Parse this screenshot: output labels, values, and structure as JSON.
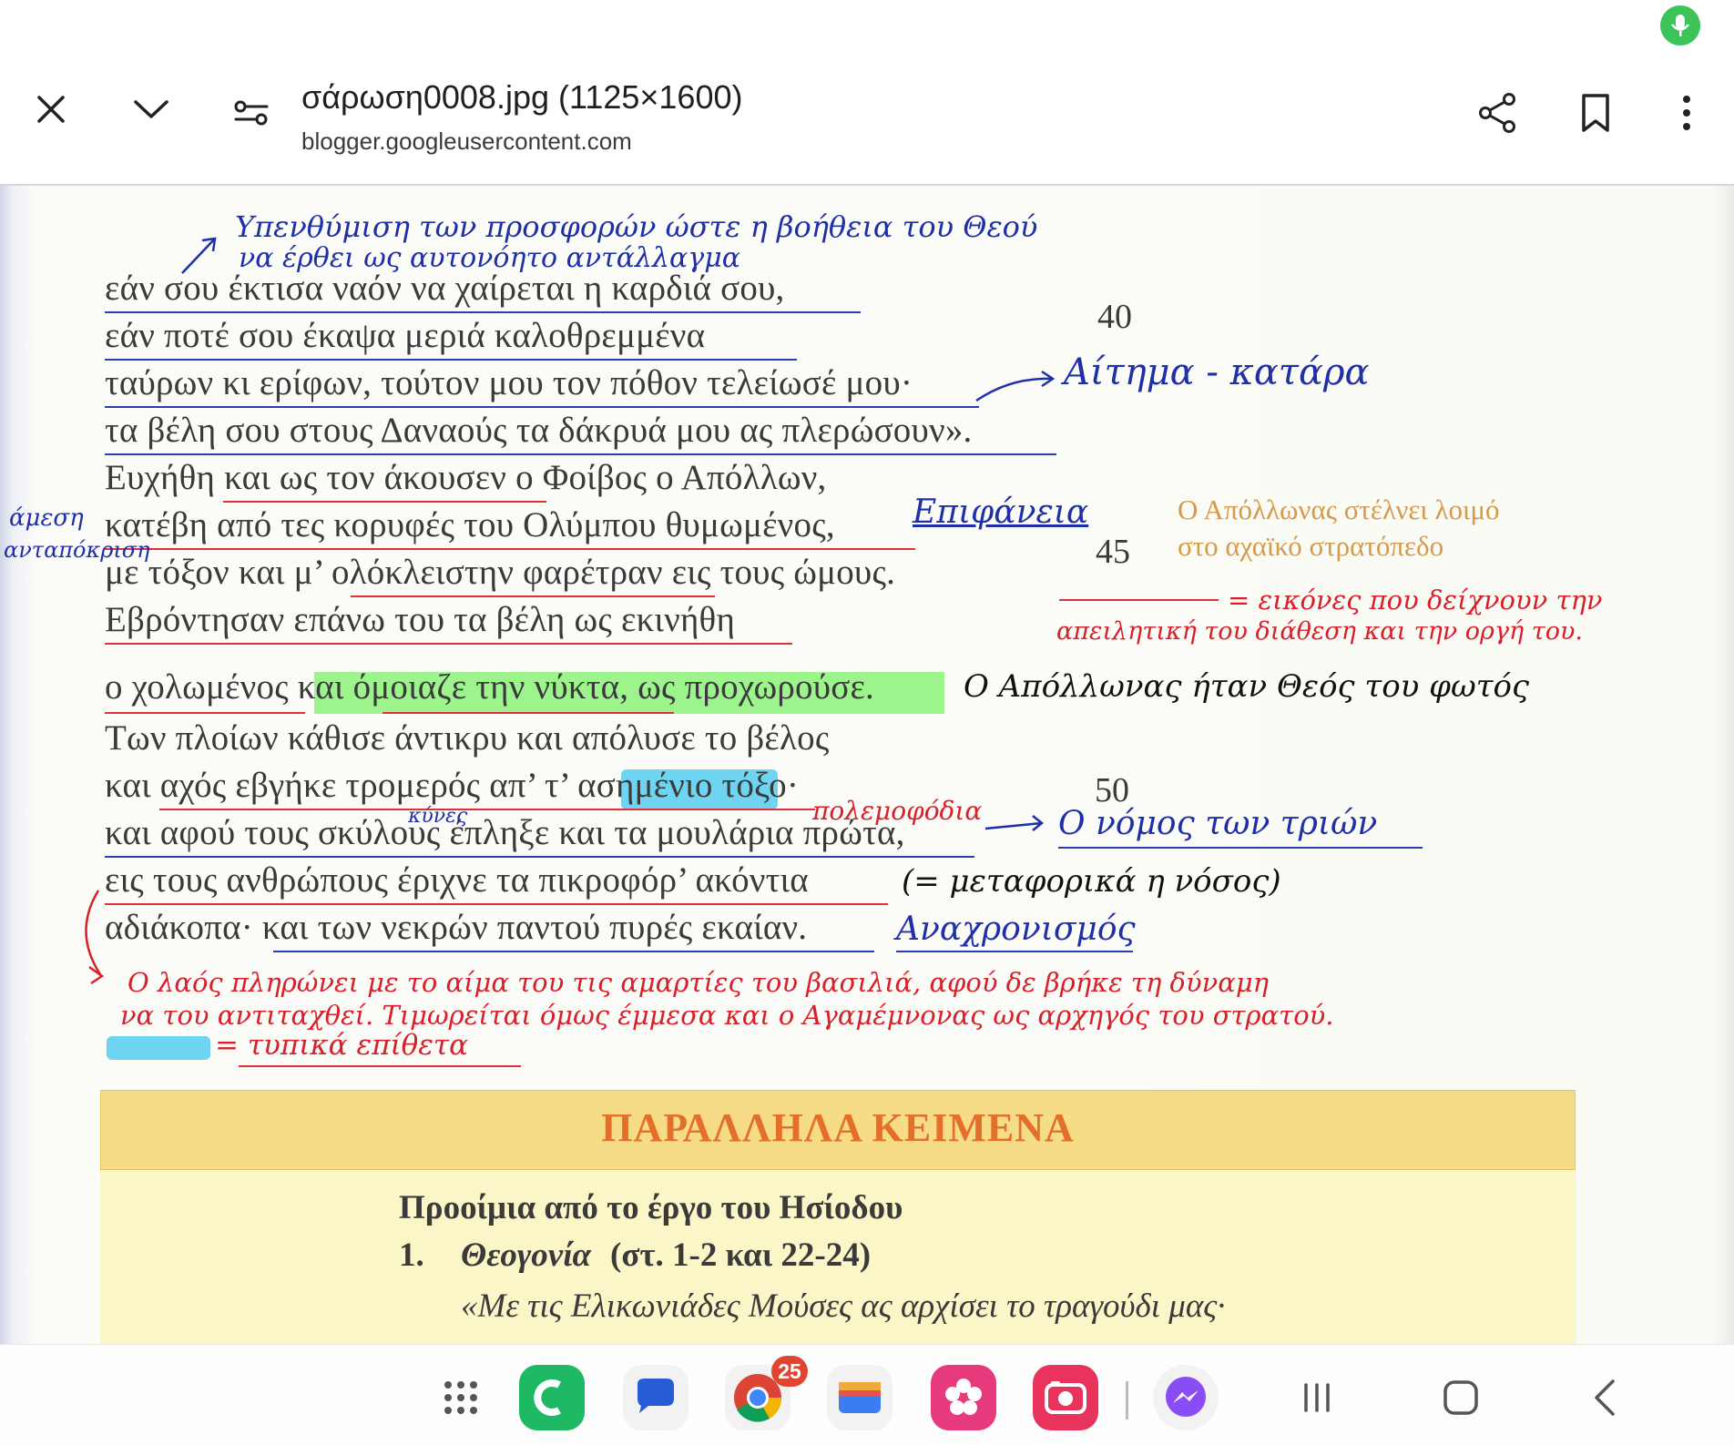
{
  "header": {
    "title": "σάρωση0008.jpg (1125×1600)",
    "url": "blogger.googleusercontent.com"
  },
  "icons": {
    "close": "close-icon",
    "collapse": "chevron-down-icon",
    "site_settings": "tune-icon",
    "share": "share-icon",
    "bookmark": "bookmark-icon",
    "menu": "more-vert-icon",
    "mic": "mic-icon"
  },
  "poem": {
    "lines": [
      "εάν σου έκτισα ναόν να χαίρεται η καρδιά σου,",
      "εάν ποτέ σου έκαψα μεριά καλοθρεμμένα",
      "ταύρων κι ερίφων, τούτον μου τον πόθον τελείωσέ μου·",
      "τα βέλη σου στους Δαναούς τα δάκρυά μου ας πλερώσουν».",
      "Ευχήθη και ως τον άκουσεν ο Φοίβος ο Απόλλων,",
      "κατέβη από τες κορυφές του Ολύμπου θυμωμένος,",
      "με τόξον και μ’ ολόκλειστην φαρέτραν εις τους ώμους.",
      "Εβρόντησαν επάνω του τα βέλη ως εκινήθη",
      "ο χολωμένος και όμοιαζε την νύκτα, ως προχωρούσε.",
      "Των πλοίων κάθισε άντικρυ και απόλυσε το βέλος",
      "και αχός εβγήκε τρομερός απ’ τ’ ασημένιο τόξο·",
      "και αφού τους σκύλους έπληξε και τα μουλάρια πρώτα,",
      "εις τους ανθρώπους έριχνε τα πικροφόρ’ ακόντια",
      "αδιάκοπα· και των νεκρών παντού πυρές εκαίαν."
    ],
    "line_numbers": [
      "40",
      "45",
      "50"
    ]
  },
  "annotations": {
    "top_note_1": "Υπενθύμιση των προσφορών ώστε η βοήθεια του Θεού",
    "top_note_2": "να έρθει ως αυτονόητο αντάλλαγμα",
    "curse": "Αίτημα - κατάρα",
    "direct_1": "άμεση",
    "direct_2": "ανταπόκριση",
    "epiphany": "Επιφάνεια",
    "side_note_1": "Ο Απόλλωνας στέλνει λοιμό",
    "side_note_2": "στο αχαϊκό στρατόπεδο",
    "images_1": "= εικόνες που δείχνουν την",
    "images_2": "απειλητική του διάθεση και την οργή του.",
    "light_god": "Ο Απόλλωνας ήταν Θεός του φωτός",
    "dogs": "κύνες",
    "pack_animals": "πολεμοφόδια",
    "law_of_three": "Ο νόμος των τριών",
    "metaphor": "(= μεταφορικά η νόσος)",
    "anachronism": "Αναχρονισμός",
    "bottom_1": "Ο λαός πληρώνει με το αίμα του τις αμαρτίες του βασιλιά, αφού δε βρήκε τη δύναμη",
    "bottom_2": "να του αντιταχθεί. Τιμωρείται όμως έμμεσα και ο Αγαμέμνονας ως αρχηγός του στρατού.",
    "epithets": "= τυπικά επίθετα"
  },
  "parallel": {
    "title": "ΠΑΡΑΛΛΗΛΑ ΚΕΙΜΕΝΑ",
    "subtitle": "Προοίμια από το έργο του Ησίοδου",
    "item_number": "1.",
    "item_title": "Θεογονία",
    "item_range": "(στ. 1-2 και 22-24)",
    "quote": "«Με τις Ελικωνιάδες Μούσες ας αρχίσει το τραγούδι μας·"
  },
  "dock": {
    "chrome_badge": "25",
    "apps": [
      "apps-grid-icon",
      "phone-icon",
      "messages-icon",
      "chrome-icon",
      "wallet-icon",
      "blossom-icon",
      "screen-recorder-icon",
      "messenger-icon"
    ],
    "nav": [
      "recents-icon",
      "home-icon",
      "back-icon"
    ]
  },
  "colors": {
    "annotation_blue": "#1f2fa8",
    "annotation_red": "#d8202a",
    "highlight_green": "#8cf27a",
    "highlight_blue": "#5fcff0",
    "parallel_band": "#f6dc86",
    "parallel_title": "#e36f2a"
  }
}
